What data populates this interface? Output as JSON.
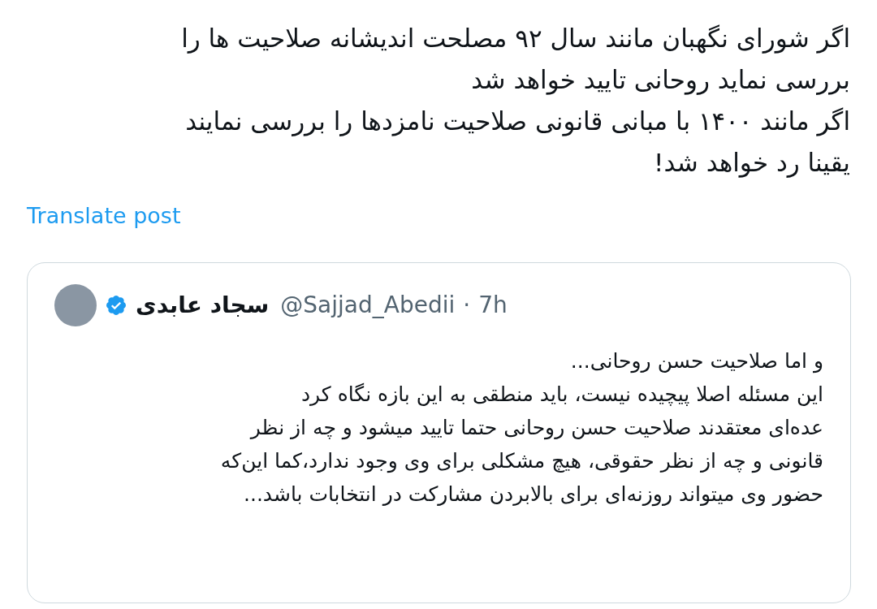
{
  "post": {
    "lines": [
      "اگر شورای نگهبان مانند سال ۹۲ مصلحت اندیشانه صلاحیت ها را",
      "بررسی نماید روحانی تایید خواهد شد",
      "اگر مانند ۱۴۰۰ با مبانی قانونی صلاحیت نامزدها را بررسی نمایند",
      "یقینا رد خواهد شد!"
    ],
    "translate_link": "Translate post"
  },
  "quoted_post": {
    "author_name": "سجاد عابدی",
    "verified": true,
    "handle": "@Sajjad_Abedii",
    "separator": "·",
    "time": "7h",
    "lines": [
      "و اما صلاحیت حسن روحانی...",
      "این مسئله اصلا پیچیده نیست، باید منطقی به این بازه نگاه کرد",
      "عده‌ای معتقدند صلاحیت حسن روحانی حتما تایید میشود و چه از نظر",
      "قانونی و چه از نظر حقوقی، هیچ مشکلی برای وی وجود ندارد،کما این‌که",
      "حضور وی میتواند روزنه‌ای برای بالابردن مشارکت در انتخابات باشد..."
    ]
  }
}
